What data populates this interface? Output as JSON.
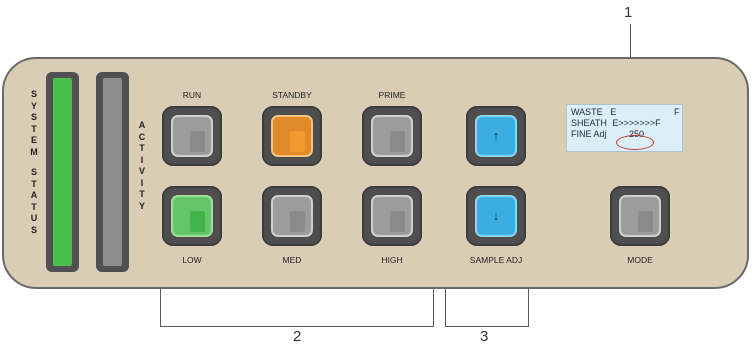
{
  "callouts": {
    "one": "1",
    "two": "2",
    "three": "3"
  },
  "system_status": [
    "S",
    "Y",
    "S",
    "T",
    "E",
    "M",
    "",
    "S",
    "T",
    "A",
    "T",
    "U",
    "S"
  ],
  "activity": [
    "A",
    "C",
    "T",
    "I",
    "V",
    "I",
    "T",
    "Y"
  ],
  "top_labels": {
    "run": "RUN",
    "standby": "STANDBY",
    "prime": "PRIME"
  },
  "bottom_labels": {
    "low": "LOW",
    "med": "MED",
    "high": "HIGH",
    "sample_adj": "SAMPLE ADJ",
    "mode": "MODE"
  },
  "display": {
    "waste_label": "WASTE",
    "waste_e": "E",
    "waste_f": "F",
    "sheath_label": "SHEATH",
    "sheath_value": "E>>>>>>>F",
    "fine_label": "FINE Adj",
    "fine_value": "250"
  },
  "arrows": {
    "up": "↑",
    "down": "↓"
  },
  "colors": {
    "status_green": "#49c04a",
    "activity_gray": "#8e8e8e",
    "standby_orange": "#f29a2e",
    "low_green": "#3fb54a",
    "arrow_blue": "#3aaee0",
    "idle_gray": "#8a8a8a",
    "panel": "#d9cdb6",
    "circle_red": "#c0392b"
  }
}
